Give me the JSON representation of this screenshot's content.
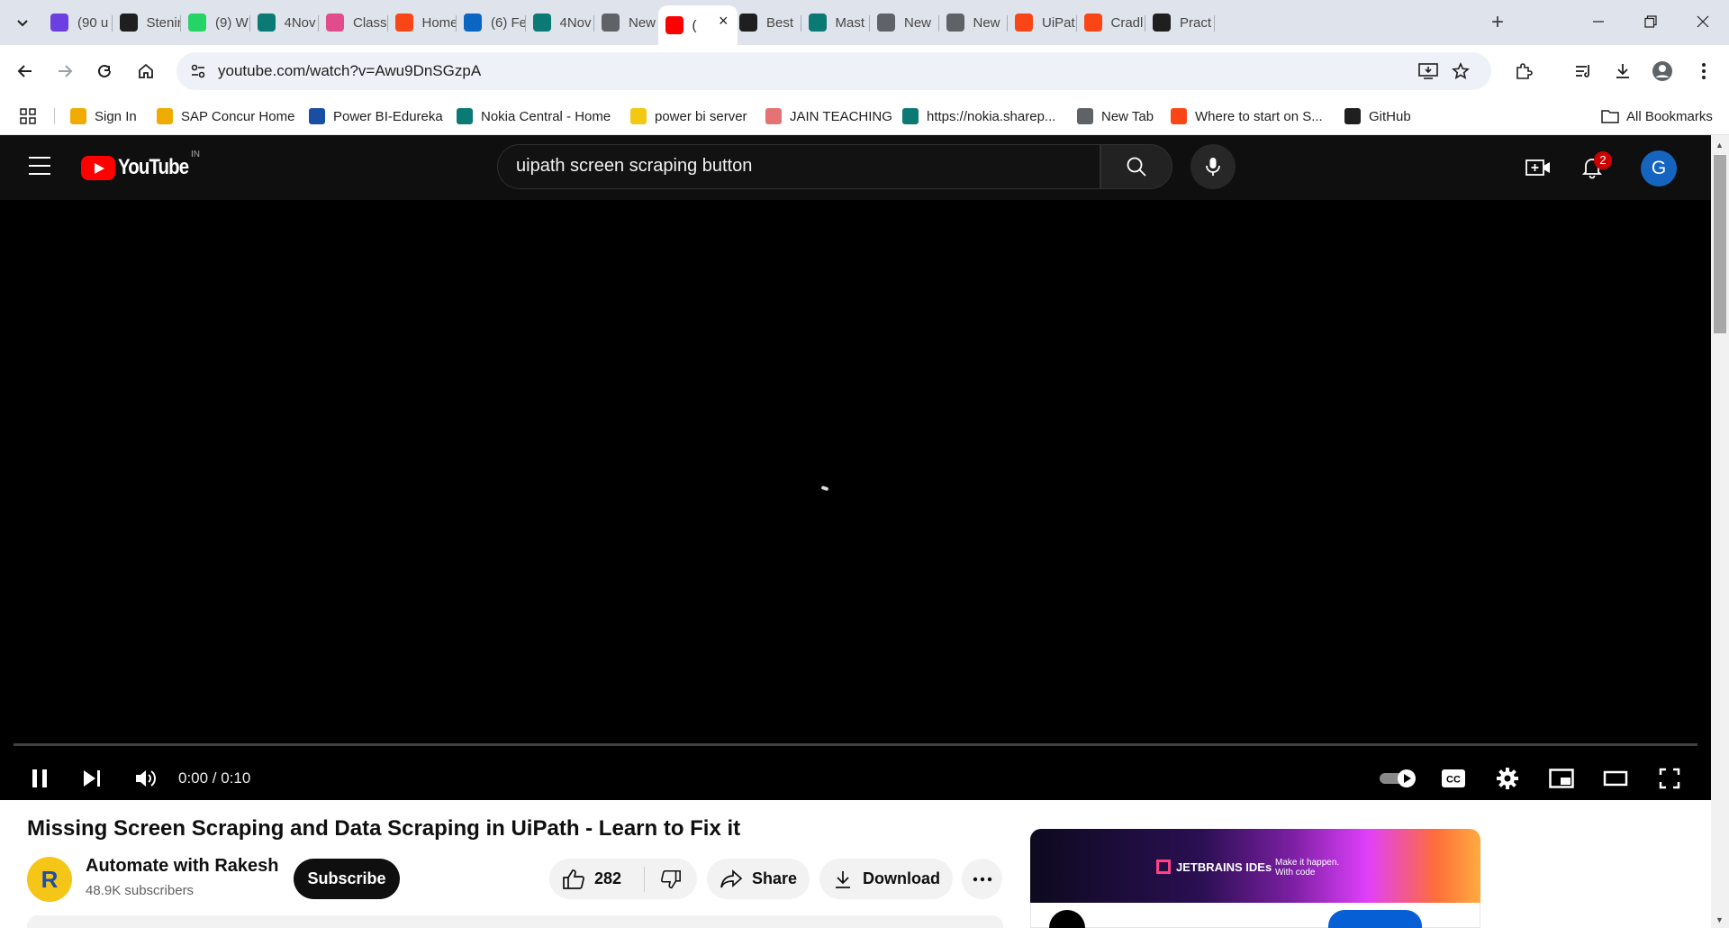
{
  "browser": {
    "tabs": [
      {
        "title": "(90 u",
        "icon": "mail-icon",
        "color": "#6b3fe0"
      },
      {
        "title": "Stenin",
        "icon": "github-icon",
        "color": "#1f1f1f"
      },
      {
        "title": "(9) W",
        "icon": "whatsapp-icon",
        "color": "#25d366"
      },
      {
        "title": "4Nov",
        "icon": "sharepoint-icon",
        "color": "#0b7a75"
      },
      {
        "title": "Class",
        "icon": "play-icon",
        "color": "#e04c8c"
      },
      {
        "title": "Home",
        "icon": "uipath-icon",
        "color": "#fa4616"
      },
      {
        "title": "(6) Fe",
        "icon": "linkedin-icon",
        "color": "#0a66c2"
      },
      {
        "title": "4Nov",
        "icon": "sharepoint-icon",
        "color": "#0b7a75"
      },
      {
        "title": "New",
        "icon": "chrome-icon",
        "color": "#5f6368"
      },
      {
        "title": "(",
        "icon": "youtube-icon",
        "color": "#ff0000"
      },
      {
        "title": "Best",
        "icon": "s-icon",
        "color": "#1f1f1f"
      },
      {
        "title": "Mast",
        "icon": "sharepoint-icon",
        "color": "#0b7a75"
      },
      {
        "title": "New",
        "icon": "chrome-icon",
        "color": "#5f6368"
      },
      {
        "title": "New",
        "icon": "chrome-icon",
        "color": "#5f6368"
      },
      {
        "title": "UiPat",
        "icon": "uipath-icon",
        "color": "#fa4616"
      },
      {
        "title": "Cradl",
        "icon": "uipath-icon",
        "color": "#fa4616"
      },
      {
        "title": "Pract",
        "icon": "github-icon",
        "color": "#1f1f1f"
      }
    ],
    "url": "youtube.com/watch?v=Awu9DnSGzpA",
    "bookmarks": [
      {
        "label": "Sign In",
        "icon": "concur-icon",
        "color": "#f0ab00"
      },
      {
        "label": "SAP Concur Home",
        "icon": "concur-icon",
        "color": "#f0ab00"
      },
      {
        "label": "Power BI-Edureka",
        "icon": "edureka-icon",
        "color": "#1a4ea3"
      },
      {
        "label": "Nokia Central - Home",
        "icon": "sharepoint-icon",
        "color": "#0b7a75"
      },
      {
        "label": "power bi server",
        "icon": "powerbi-icon",
        "color": "#f2c811"
      },
      {
        "label": "JAIN TEACHING",
        "icon": "jain-icon",
        "color": "#e57373"
      },
      {
        "label": "https://nokia.sharep...",
        "icon": "sharepoint-icon",
        "color": "#0b7a75"
      },
      {
        "label": "New Tab",
        "icon": "globe-icon",
        "color": "#5f6368"
      },
      {
        "label": "Where to start on S...",
        "icon": "uipath-icon",
        "color": "#fa4616"
      },
      {
        "label": "GitHub",
        "icon": "github-icon",
        "color": "#1f1f1f"
      }
    ],
    "all_bookmarks": "All Bookmarks"
  },
  "youtube": {
    "logo_text": "YouTube",
    "country": "IN",
    "search_value": "uipath screen scraping button",
    "notification_count": "2",
    "avatar_letter": "G",
    "player": {
      "time": "0:00 / 0:10",
      "progress": 0
    },
    "video": {
      "title": "Missing Screen Scraping and Data Scraping in UiPath - Learn to Fix it",
      "channel": "Automate with Rakesh",
      "subscribers": "48.9K subscribers",
      "subscribe_label": "Subscribe",
      "likes": "282",
      "share_label": "Share",
      "download_label": "Download",
      "channel_avatar_letter": "R"
    },
    "ad": {
      "brand": "JETBRAINS IDEs",
      "tagline_1": "Make it happen.",
      "tagline_2": "With code"
    }
  },
  "colors": {
    "yt_red": "#ff0000",
    "yt_dark": "#0f0f0f",
    "avatar_blue": "#1565c0",
    "tabstrip": "#dfe3eb"
  }
}
